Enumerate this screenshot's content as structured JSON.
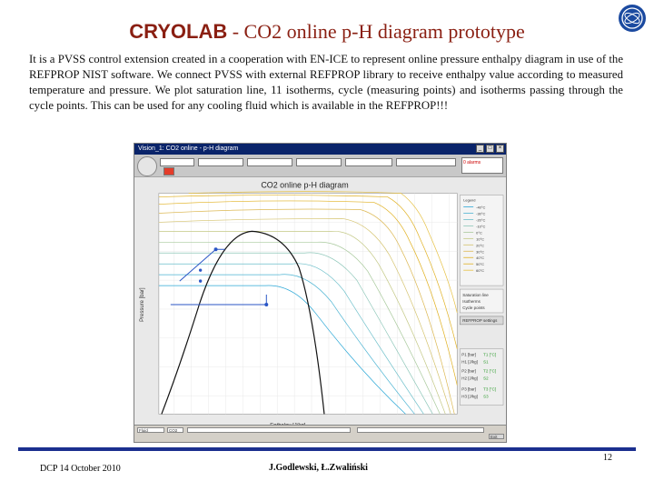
{
  "slide": {
    "title_brand": "CRYOLAB",
    "title_rest": " - CO2 online p-H diagram prototype",
    "description": "It is a PVSS control extension created in a cooperation with EN-ICE to represent online pressure enthalpy diagram in use of the REFPROP NIST software. We connect PVSS with external REFPROP library to receive enthalpy value according to measured temperature and pressure. We plot saturation line, 11 isotherms, cycle (measuring points) and isotherms passing through the cycle points. This can be used for any cooling fluid which is available in the REFPROP!!!",
    "footer_date": "DCP 14 October 2010",
    "footer_authors": "J.Godlewski, Ł.Zwaliński",
    "page_number": "12"
  },
  "screenshot": {
    "window_title": "Vision_1: CO2 online - p-H diagram",
    "alarm_label": "0 alarms",
    "chart_title": "CO2 online p-H diagram",
    "x_label": "Enthalpy [J/kg]",
    "y_label": "Pressure [bar]",
    "legend_title": "Legend",
    "isotherm_legend": [
      "-40°C",
      "-30°C",
      "-20°C",
      "-10°C",
      "0°C",
      "10°C",
      "20°C",
      "30°C",
      "40°C",
      "50°C",
      "60°C"
    ],
    "info_lines": [
      "Saturation line",
      "Isotherms",
      "Cycle points"
    ],
    "button_label": "REFPROP settings",
    "point_values": [
      [
        "P1 [bar]",
        "T1 [°C]"
      ],
      [
        "H1 [J/kg]",
        "S1"
      ],
      [
        "P2 [bar]",
        "T2 [°C]"
      ],
      [
        "H2 [J/kg]",
        "S2"
      ],
      [
        "P3 [bar]",
        "T3 [°C]"
      ],
      [
        "H3 [J/kg]",
        "S3"
      ]
    ],
    "statusbar_left": "Fluid",
    "statusbar_mid": "CO2",
    "statusbar_right": "Exit",
    "colors": {
      "titlebar": "#0a246a",
      "saturation": "#111111",
      "cycle": "#2a56c6",
      "isotherm_cold": "#2aa7d6",
      "isotherm_hot": "#e0b020"
    }
  }
}
